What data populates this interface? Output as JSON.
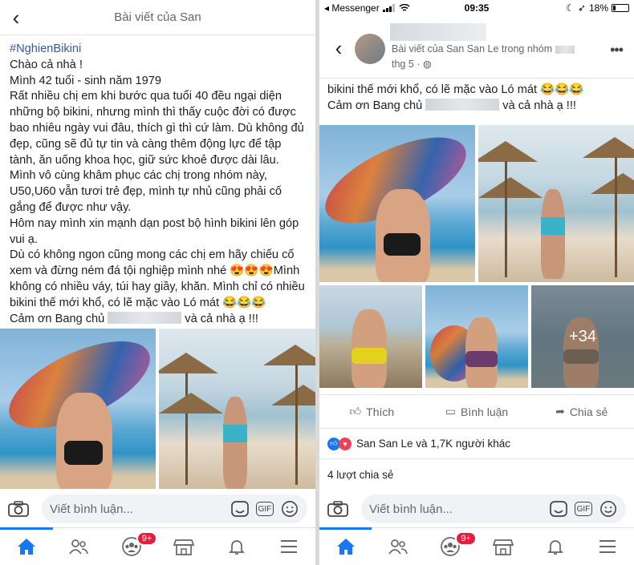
{
  "left": {
    "header_title": "Bài viết của San",
    "lines": [
      "#NghienBikini",
      "Chào cả nhà !",
      "Mình 42 tuổi - sinh năm 1979",
      "Rất nhiều chị em khi bước qua tuổi 40 đều ngại diện những bộ bikini, nhưng mình thì thấy cuộc đời có được bao nhiêu ngày vui đâu, thích gì thì cứ làm. Dù không đủ đẹp, cũng sẽ đủ tự tin và càng thêm động lực để tập tành, ăn uống khoa học, giữ sức khoẻ được dài lâu.",
      "Mình vô cùng khâm phục các chị trong nhóm này, U50,U60 vẫn tươi trẻ đẹp, mình tự nhủ cũng phải cố gắng để được như vậy.",
      "Hôm nay mình xin mạnh dạn post bộ hình bikini lên góp vui ạ.",
      "Dù có không ngon cũng mong các chị em hãy chiếu cố xem và đừng ném đá tội nghiệp mình nhé 😍😍😍Mình không có nhiều váy, túi hay giầy, khăn. Mình chỉ có nhiều bikini thế mới khổ, có lẽ mặc vào Ló mát 😂😂😂",
      "Cảm ơn Bang chủ",
      "và cả nhà ạ !!!"
    ],
    "comment_placeholder": "Viết bình luận...",
    "gif_label": "GIF"
  },
  "right": {
    "status": {
      "carrier": "◂ Messenger",
      "time": "09:35",
      "battery": "18%"
    },
    "header_sub": "Bài viết của San San Le trong nhóm",
    "header_date": "thg 5 ·",
    "lines": [
      "bikini thế mới khổ, có lẽ mặc vào Ló mát 😂😂😂",
      "Cảm ơn Bang chủ",
      "và cả nhà ạ !!!"
    ],
    "more_photos": "+34",
    "actions": {
      "like": "Thích",
      "comment": "Bình luận",
      "share": "Chia sẻ"
    },
    "reactions_text": "San San Le và 1,7K người khác",
    "shares_text": "4 lượt chia sẻ",
    "comment_placeholder": "Viết bình luận...",
    "gif_label": "GIF"
  },
  "tabbar": {
    "notif_badge": "9+"
  }
}
